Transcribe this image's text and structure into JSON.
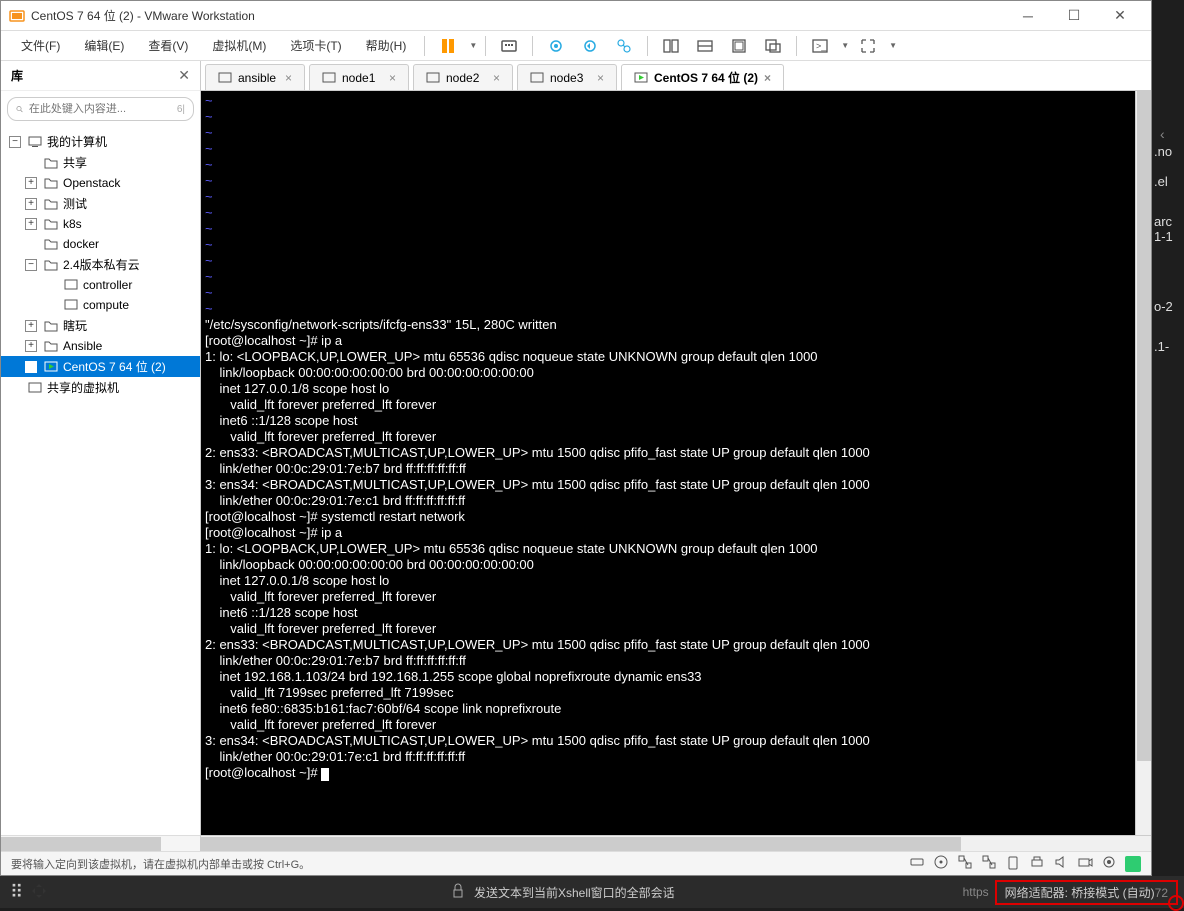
{
  "window": {
    "title": "CentOS 7 64 位 (2) - VMware Workstation"
  },
  "menu": {
    "file": "文件(F)",
    "edit": "编辑(E)",
    "view": "查看(V)",
    "vm": "虚拟机(M)",
    "tabs": "选项卡(T)",
    "help": "帮助(H)"
  },
  "sidebar": {
    "title": "库",
    "search_placeholder": "在此处键入内容进...",
    "search_hint": "6|",
    "tree": {
      "root": "我的计算机",
      "share": "共享",
      "openstack": "Openstack",
      "test": "测试",
      "k8s": "k8s",
      "docker": "docker",
      "cloud24": "2.4版本私有云",
      "controller": "controller",
      "compute": "compute",
      "play": "瞎玩",
      "ansible": "Ansible",
      "centos": "CentOS 7 64 位 (2)",
      "shared_vm": "共享的虚拟机"
    }
  },
  "tabs": {
    "ansible": "ansible",
    "node1": "node1",
    "node2": "node2",
    "node3": "node3",
    "active": "CentOS 7 64 位 (2)"
  },
  "terminal": "~\n~\n~\n~\n~\n~\n~\n~\n~\n~\n~\n~\n~\n~\n\"/etc/sysconfig/network-scripts/ifcfg-ens33\" 15L, 280C written\n[root@localhost ~]# ip a\n1: lo: <LOOPBACK,UP,LOWER_UP> mtu 65536 qdisc noqueue state UNKNOWN group default qlen 1000\n    link/loopback 00:00:00:00:00:00 brd 00:00:00:00:00:00\n    inet 127.0.0.1/8 scope host lo\n       valid_lft forever preferred_lft forever\n    inet6 ::1/128 scope host\n       valid_lft forever preferred_lft forever\n2: ens33: <BROADCAST,MULTICAST,UP,LOWER_UP> mtu 1500 qdisc pfifo_fast state UP group default qlen 1000\n    link/ether 00:0c:29:01:7e:b7 brd ff:ff:ff:ff:ff:ff\n3: ens34: <BROADCAST,MULTICAST,UP,LOWER_UP> mtu 1500 qdisc pfifo_fast state UP group default qlen 1000\n    link/ether 00:0c:29:01:7e:c1 brd ff:ff:ff:ff:ff:ff\n[root@localhost ~]# systemctl restart network\n[root@localhost ~]# ip a\n1: lo: <LOOPBACK,UP,LOWER_UP> mtu 65536 qdisc noqueue state UNKNOWN group default qlen 1000\n    link/loopback 00:00:00:00:00:00 brd 00:00:00:00:00:00\n    inet 127.0.0.1/8 scope host lo\n       valid_lft forever preferred_lft forever\n    inet6 ::1/128 scope host\n       valid_lft forever preferred_lft forever\n2: ens33: <BROADCAST,MULTICAST,UP,LOWER_UP> mtu 1500 qdisc pfifo_fast state UP group default qlen 1000\n    link/ether 00:0c:29:01:7e:b7 brd ff:ff:ff:ff:ff:ff\n    inet 192.168.1.103/24 brd 192.168.1.255 scope global noprefixroute dynamic ens33\n       valid_lft 7199sec preferred_lft 7199sec\n    inet6 fe80::6835:b161:fac7:60bf/64 scope link noprefixroute\n       valid_lft forever preferred_lft forever\n3: ens34: <BROADCAST,MULTICAST,UP,LOWER_UP> mtu 1500 qdisc pfifo_fast state UP group default qlen 1000\n    link/ether 00:0c:29:01:7e:c1 brd ff:ff:ff:ff:ff:ff\n[root@localhost ~]# ",
  "statusbar": {
    "hint": "要将输入定向到该虚拟机，请在虚拟机内部单击或按 Ctrl+G。"
  },
  "taskbar": {
    "xshell": "发送文本到当前Xshell窗口的全部会话",
    "net": "网络适配器: 桥接模式 (自动)",
    "url_hint": "https",
    "port_hint": "72"
  },
  "right_strip": {
    "f1": ".no",
    "f2": ".el",
    "f3": "arc",
    "f4": "1-1",
    "f5": "o-2",
    "f6": ".1-"
  }
}
